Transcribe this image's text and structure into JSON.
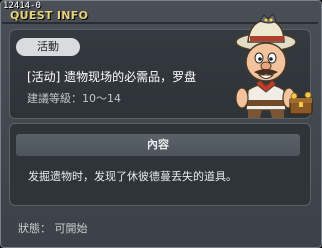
{
  "window": {
    "id_label": "12414-0",
    "title": "QUEST INFO"
  },
  "quest": {
    "category_badge": "活動",
    "name": "[活动] 遗物现场的必需品，罗盘",
    "recommended_level": "建議等級：10～14",
    "npc_icon": "explorer-npc-icon"
  },
  "description": {
    "header": "內容",
    "text": "发掘遗物时，发现了休彼德蔓丢失的道具。"
  },
  "status": {
    "text": "狀態： 可開始"
  },
  "colors": {
    "title": "#e8d27a",
    "panel_bg": "#2f3439",
    "window_bg": "#4a4f55",
    "badge_bg": "#d9dcdf"
  }
}
